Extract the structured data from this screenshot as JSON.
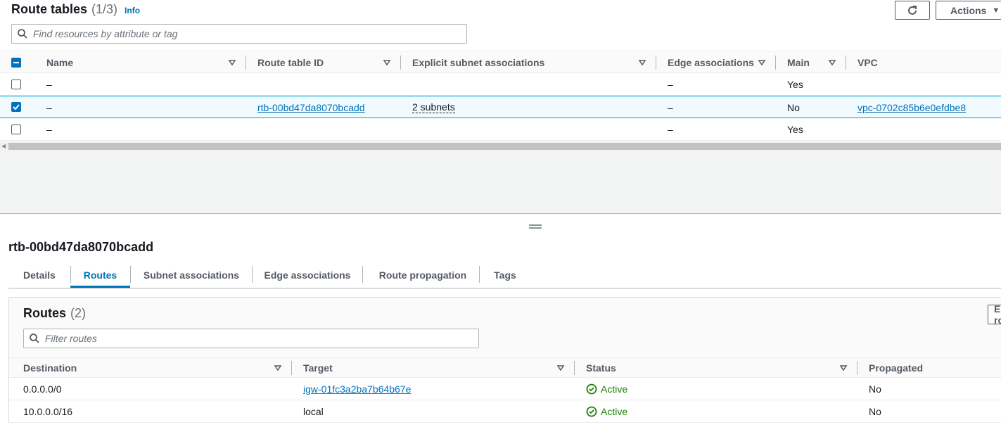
{
  "header": {
    "title": "Route tables",
    "count": "(1/3)",
    "info_label": "Info",
    "actions_label": "Actions"
  },
  "search": {
    "placeholder": "Find resources by attribute or tag"
  },
  "table": {
    "columns": [
      "Name",
      "Route table ID",
      "Explicit subnet associations",
      "Edge associations",
      "Main",
      "VPC"
    ],
    "rows": [
      {
        "checked": false,
        "name": "–",
        "route_table_id": "",
        "explicit_subnets": "",
        "edge": "–",
        "main": "Yes",
        "vpc": ""
      },
      {
        "checked": true,
        "name": "–",
        "route_table_id": "rtb-00bd47da8070bcadd",
        "explicit_subnets": "2 subnets",
        "edge": "–",
        "main": "No",
        "vpc": "vpc-0702c85b6e0efdbe8"
      },
      {
        "checked": false,
        "name": "–",
        "route_table_id": "",
        "explicit_subnets": "",
        "edge": "–",
        "main": "Yes",
        "vpc": ""
      }
    ]
  },
  "detail": {
    "title": "rtb-00bd47da8070bcadd",
    "tabs": [
      "Details",
      "Routes",
      "Subnet associations",
      "Edge associations",
      "Route propagation",
      "Tags"
    ],
    "active_tab": "Routes"
  },
  "routes": {
    "title": "Routes",
    "count": "(2)",
    "edit_label": "Edit routes",
    "filter_placeholder": "Filter routes",
    "columns": [
      "Destination",
      "Target",
      "Status",
      "Propagated"
    ],
    "rows": [
      {
        "destination": "0.0.0.0/0",
        "target": "igw-01fc3a2ba7b64b67e",
        "target_link": true,
        "status": "Active",
        "propagated": "No"
      },
      {
        "destination": "10.0.0.0/16",
        "target": "local",
        "target_link": false,
        "status": "Active",
        "propagated": "No"
      }
    ]
  },
  "colors": {
    "link": "#0073bb",
    "success": "#1d8102",
    "selected_bg": "#f1faff",
    "selected_border": "#00a1c9"
  }
}
